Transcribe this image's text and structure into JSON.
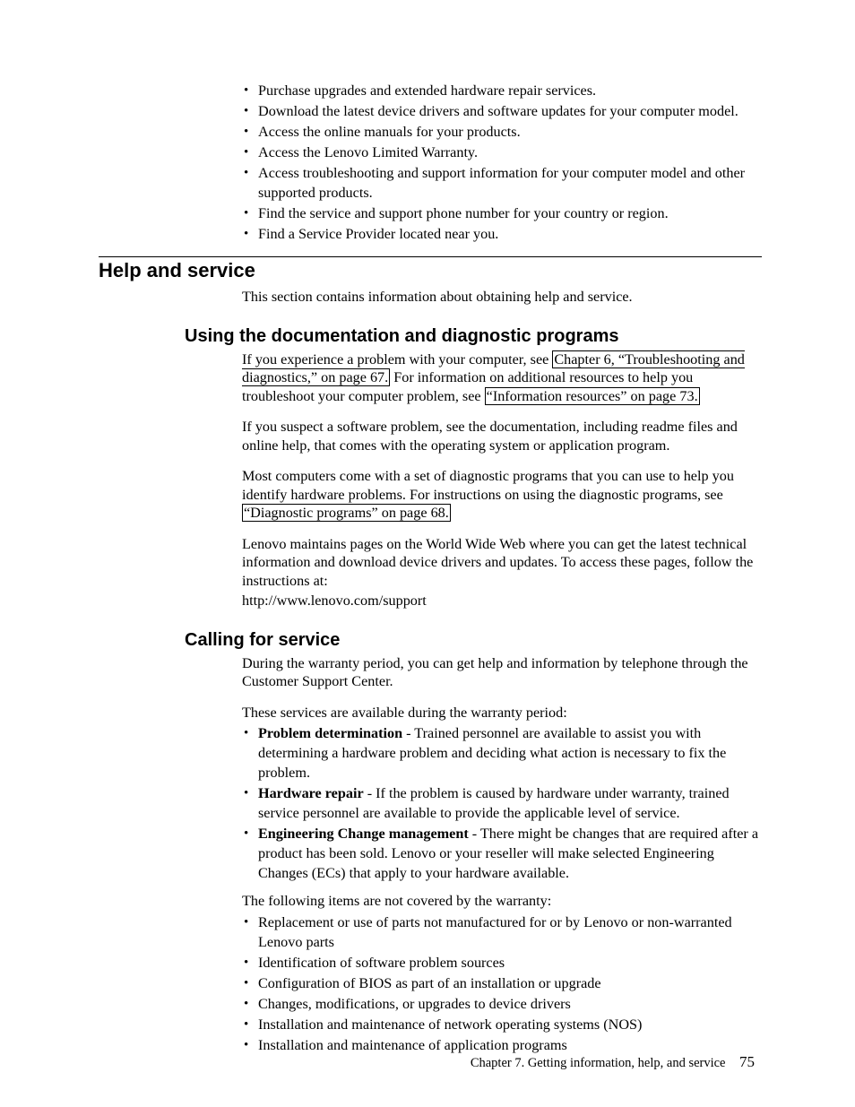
{
  "top_bullets": [
    "Purchase upgrades and extended hardware repair services.",
    "Download the latest device drivers and software updates for your computer model.",
    "Access the online manuals for your products.",
    "Access the Lenovo Limited Warranty.",
    "Access troubleshooting and support information for your computer model and other supported products.",
    "Find the service and support phone number for your country or region.",
    "Find a Service Provider located near you."
  ],
  "help_service": {
    "heading": "Help and service",
    "intro": "This section contains information about obtaining help and service."
  },
  "using_docs": {
    "heading": "Using the documentation and diagnostic programs",
    "p1_pre": "If you experience a problem with your computer, see ",
    "p1_link1": "Chapter 6, “Troubleshooting and diagnostics,” on page 67.",
    "p1_mid": " For information on additional resources to help you troubleshoot your computer problem, see ",
    "p1_link2": "“Information resources” on page 73.",
    "p2": "If you suspect a software problem, see the documentation, including readme files and online help, that comes with the operating system or application program.",
    "p3_pre": "Most computers come with a set of diagnostic programs that you can use to help you identify hardware problems. For instructions on using the diagnostic programs, see ",
    "p3_link": "“Diagnostic programs” on page 68.",
    "p4": "Lenovo maintains pages on the World Wide Web where you can get the latest technical information and download device drivers and updates. To access these pages, follow the instructions at:",
    "p4_url": "http://www.lenovo.com/support"
  },
  "calling": {
    "heading": "Calling for service",
    "p1": "During the warranty period, you can get help and information by telephone through the Customer Support Center.",
    "p2": "These services are available during the warranty period:",
    "services": [
      {
        "term": "Problem determination",
        "desc": " - Trained personnel are available to assist you with determining a hardware problem and deciding what action is necessary to fix the problem."
      },
      {
        "term": "Hardware repair",
        "desc": " - If the problem is caused by hardware under warranty, trained service personnel are available to provide the applicable level of service."
      },
      {
        "term": "Engineering Change management",
        "desc": " - There might be changes that are required after a product has been sold. Lenovo or your reseller will make selected Engineering Changes (ECs) that apply to your hardware available."
      }
    ],
    "p3": "The following items are not covered by the warranty:",
    "not_covered": [
      "Replacement or use of parts not manufactured for or by Lenovo or non-warranted Lenovo parts",
      "Identification of software problem sources",
      "Configuration of BIOS as part of an installation or upgrade",
      "Changes, modifications, or upgrades to device drivers",
      "Installation and maintenance of network operating systems (NOS)",
      "Installation and maintenance of application programs"
    ]
  },
  "footer": {
    "chapter": "Chapter 7. Getting information, help, and service",
    "page": "75"
  }
}
